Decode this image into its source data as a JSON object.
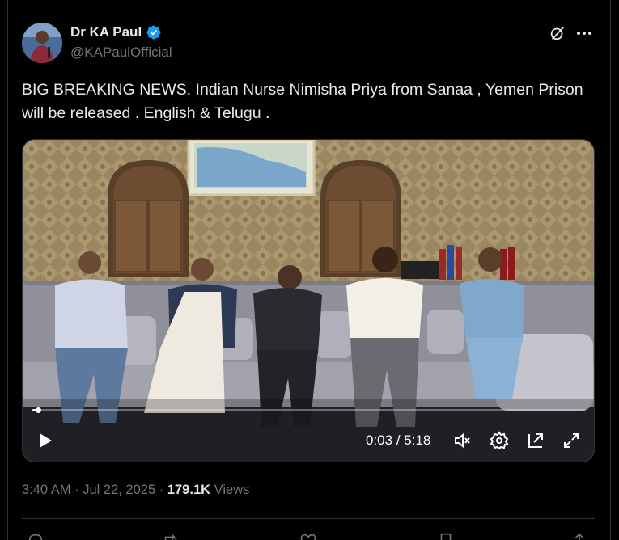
{
  "author": {
    "display_name": "Dr KA Paul",
    "handle": "@KAPaulOfficial",
    "verified": true
  },
  "tweet": {
    "text": "BIG BREAKING NEWS. Indian Nurse Nimisha Priya from Sanaa , Yemen Prison will be released . English & Telugu ."
  },
  "video": {
    "current_time": "0:03",
    "separator": "/",
    "duration": "5:18",
    "progress": 0.01,
    "icons": [
      "play-icon",
      "mute-icon",
      "settings-icon",
      "pop-out-icon",
      "fullscreen-icon"
    ]
  },
  "meta": {
    "time": "3:40 AM",
    "dot": "·",
    "date": "Jul 22, 2025",
    "views_count": "179.1K",
    "views_label": "Views"
  },
  "actions": [
    {
      "name": "reply",
      "icon": "reply-icon"
    },
    {
      "name": "repost",
      "icon": "repost-icon"
    },
    {
      "name": "like",
      "icon": "heart-icon"
    },
    {
      "name": "bookmark",
      "icon": "bookmark-icon"
    },
    {
      "name": "share",
      "icon": "share-icon"
    }
  ],
  "colors": {
    "background": "#000000",
    "text": "#e7e9ea",
    "secondary": "#71767b",
    "verified": "#1d9bf0",
    "border": "#2f3336"
  }
}
